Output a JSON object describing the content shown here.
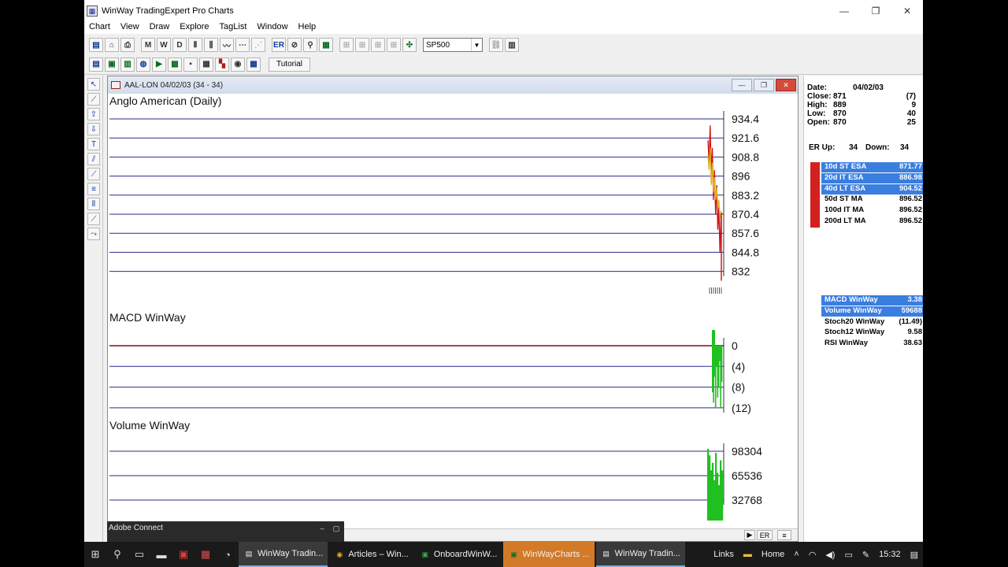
{
  "window": {
    "title": "WinWay TradingExpert Pro Charts"
  },
  "menu": [
    "Chart",
    "View",
    "Draw",
    "Explore",
    "TagList",
    "Window",
    "Help"
  ],
  "toolbar": {
    "buttons": [
      "M",
      "W",
      "D",
      "ER"
    ],
    "symbol": "SP500",
    "tutorial_label": "Tutorial"
  },
  "chart_window": {
    "title": "AAL-LON 04/02/03 (34 - 34)"
  },
  "chart_data": [
    {
      "type": "line",
      "title": "Anglo American (Daily)",
      "y_ticks": [
        "934.4",
        "921.6",
        "908.8",
        "896",
        "883.2",
        "870.4",
        "857.6",
        "844.8",
        "832"
      ],
      "ylim": [
        832,
        934.4
      ],
      "series": [
        {
          "values": [
            920,
            905,
            930,
            895,
            915,
            880,
            900,
            870,
            890,
            860,
            875,
            845,
            870,
            871
          ]
        },
        {
          "values": [
            910,
            900,
            915,
            890,
            905,
            885,
            895,
            880,
            888,
            875,
            880,
            868,
            872,
            871
          ]
        }
      ]
    },
    {
      "type": "bar",
      "title": "MACD WinWay",
      "y_ticks": [
        "0",
        "(4)",
        "(8)",
        "(12)"
      ],
      "ylim": [
        -12,
        0
      ],
      "values": [
        -9,
        -11,
        -6,
        -12,
        -4,
        -10,
        -8,
        -3,
        -12,
        -7
      ]
    },
    {
      "type": "bar",
      "title": "Volume WinWay",
      "y_ticks": [
        "98304",
        "65536",
        "32768"
      ],
      "ylim": [
        0,
        98304
      ],
      "values": [
        110000,
        90000,
        60000,
        75000,
        40000,
        95000,
        55000,
        30000,
        80000,
        59688
      ]
    }
  ],
  "data_panel": {
    "date_label": "Date:",
    "date": "04/02/03",
    "close_label": "Close:",
    "close": "871",
    "close_chg": "(7)",
    "high_label": "High:",
    "high": "889",
    "high_chg": "9",
    "low_label": "Low:",
    "low": "870",
    "low_chg": "40",
    "open_label": "Open:",
    "open": "870",
    "open_chg": "25",
    "er_text": "ER Up:",
    "er_up": "34",
    "er_down_text": "Down:",
    "er_down": "34"
  },
  "averages": [
    {
      "name": "10d ST ESA",
      "value": "871.77",
      "highlight": true
    },
    {
      "name": "20d IT ESA",
      "value": "886.98",
      "highlight": true
    },
    {
      "name": "40d LT ESA",
      "value": "904.52",
      "highlight": true
    },
    {
      "name": "50d ST MA",
      "value": "896.52",
      "highlight": false
    },
    {
      "name": "100d IT MA",
      "value": "896.52",
      "highlight": false
    },
    {
      "name": "200d LT MA",
      "value": "896.52",
      "highlight": false
    }
  ],
  "indicators": [
    {
      "name": "MACD WinWay",
      "value": "3.38",
      "highlight": true
    },
    {
      "name": "Volume WinWay",
      "value": "59688",
      "highlight": true
    },
    {
      "name": "Stoch20 WinWay",
      "value": "(11.49)",
      "highlight": false
    },
    {
      "name": "Stoch12 WinWay",
      "value": "9.58",
      "highlight": false
    },
    {
      "name": "RSI WinWay",
      "value": "38.63",
      "highlight": false
    }
  ],
  "bottom_bar": {
    "er_label": "ER"
  },
  "adobe_connect": {
    "title": "Adobe Connect"
  },
  "taskbar": {
    "apps": [
      "WinWay Tradin...",
      "Articles – Win...",
      "OnboardWinW...",
      "WinWayCharts ...",
      "WinWay Tradin..."
    ],
    "links": "Links",
    "home": "Home",
    "time": "15:32"
  },
  "colors": {
    "price_red": "#cc1010",
    "price_yellow": "#e0b020",
    "macd_green": "#20c020",
    "grid_blue": "#2a2a8a",
    "zero_line": "#7a1010"
  }
}
